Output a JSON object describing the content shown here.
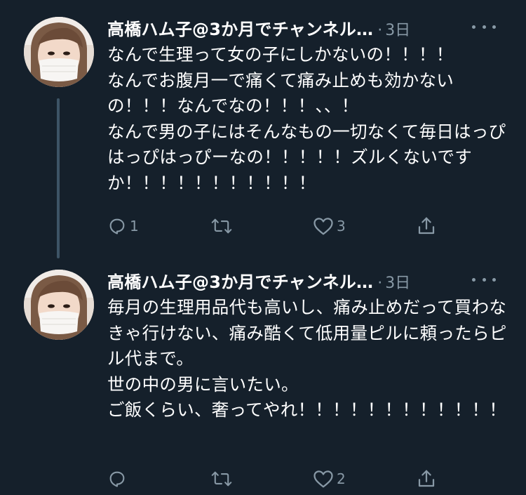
{
  "tweets": [
    {
      "display_name": "高橋ハム子@3か月でチャンネル…",
      "separator": "·",
      "timestamp": "3日",
      "text": "なんで生理って女の子にしかないの！！！！\nなんでお腹月一で痛くて痛み止めも効かないの！！！なんでなの！！！、、！\nなんで男の子にはそんなもの一切なくて毎日はっぴはっぴはっぴーなの！！！！！ズルくないですか！！！！！！！！！！！",
      "replies": "1",
      "retweets": "",
      "likes": "3",
      "icons": {
        "reply": "reply-icon",
        "retweet": "retweet-icon",
        "like": "heart-icon",
        "share": "share-icon"
      }
    },
    {
      "display_name": "高橋ハム子@3か月でチャンネル…",
      "separator": "·",
      "timestamp": "3日",
      "text": "毎月の生理用品代も高いし、痛み止めだって買わなきゃ行けない、痛み酷くて低用量ピルに頼ったらピル代まで。\n世の中の男に言いたい。\nご飯くらい、奢ってやれ！！！！！！！！！！！！",
      "replies": "",
      "retweets": "",
      "likes": "2",
      "icons": {
        "reply": "reply-icon",
        "retweet": "retweet-icon",
        "like": "heart-icon",
        "share": "share-icon"
      }
    }
  ],
  "colors": {
    "background": "#15202b",
    "text": "#ffffff",
    "secondary": "#8899a6",
    "thread_line": "#3d5466"
  }
}
